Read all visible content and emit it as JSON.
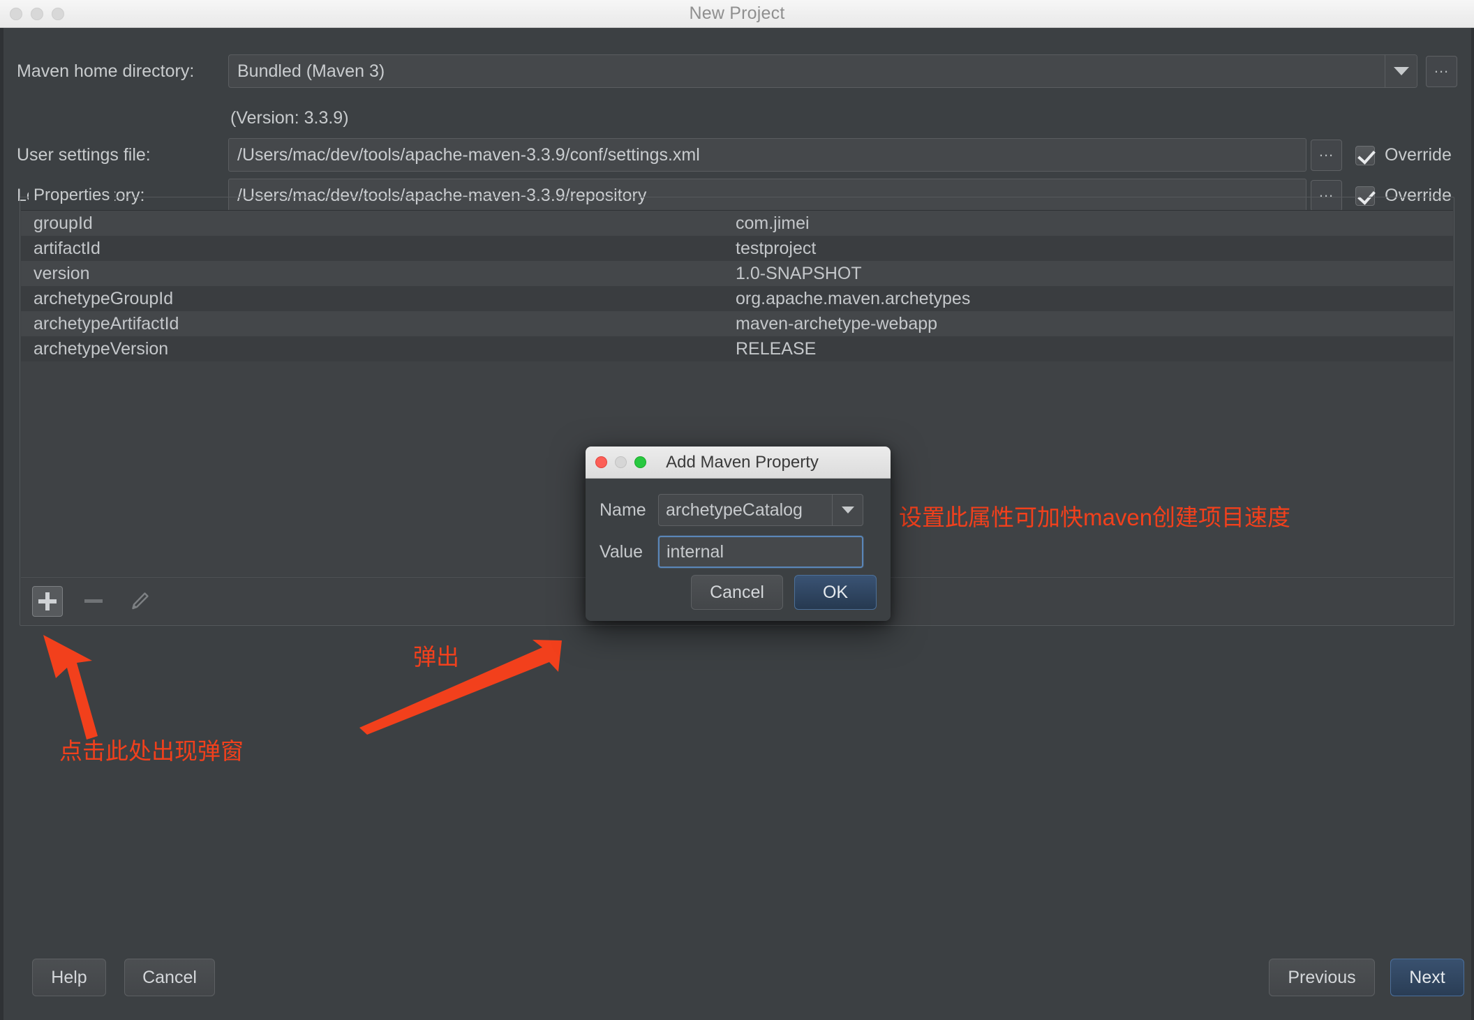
{
  "window": {
    "title": "New Project",
    "traffic_lights": [
      "close",
      "minimize",
      "maximize"
    ]
  },
  "form": {
    "maven_home": {
      "label": "Maven home directory:",
      "value": "Bundled (Maven 3)",
      "dropdown_icon": "chevron-down-icon",
      "browse_label": "...",
      "version_note": "(Version: 3.3.9)"
    },
    "user_settings": {
      "label": "User settings file:",
      "value": "/Users/mac/dev/tools/apache-maven-3.3.9/conf/settings.xml",
      "browse_label": "...",
      "override_label": "Override",
      "override_checked": true
    },
    "local_repository": {
      "label": "Local repository:",
      "value": "/Users/mac/dev/tools/apache-maven-3.3.9/repository",
      "browse_label": "...",
      "override_label": "Override",
      "override_checked": true
    }
  },
  "properties": {
    "legend": "Properties",
    "rows": [
      {
        "key": "groupId",
        "value": "com.jimei"
      },
      {
        "key": "artifactId",
        "value": "testproject"
      },
      {
        "key": "version",
        "value": "1.0-SNAPSHOT"
      },
      {
        "key": "archetypeGroupId",
        "value": "org.apache.maven.archetypes"
      },
      {
        "key": "archetypeArtifactId",
        "value": "maven-archetype-webapp"
      },
      {
        "key": "archetypeVersion",
        "value": "RELEASE"
      }
    ],
    "toolbar": {
      "add_icon": "plus-icon",
      "remove_icon": "minus-icon",
      "edit_icon": "pencil-icon"
    }
  },
  "footer": {
    "help_label": "Help",
    "cancel_label": "Cancel",
    "previous_label": "Previous",
    "next_label": "Next"
  },
  "dialog": {
    "title": "Add Maven Property",
    "name_label": "Name",
    "name_value": "archetypeCatalog",
    "name_dropdown_icon": "chevron-down-icon",
    "value_label": "Value",
    "value_value": "internal",
    "cancel_label": "Cancel",
    "ok_label": "OK"
  },
  "annotations": {
    "color": "#f2401c",
    "note_property": "设置此属性可加快maven创建项目速度",
    "note_popup": "弹出",
    "note_click": "点击此处出现弹窗",
    "arrow_to_add_button": "arrow-icon",
    "arrow_to_dialog": "arrow-icon"
  },
  "colors": {
    "window_background": "#3c4043",
    "titlebar": "#eeeeee",
    "field_background": "#45484b",
    "row_odd": "#44474a",
    "row_even": "#3a3d40",
    "primary_button": "#344d6c",
    "annotation_red": "#f2401c"
  }
}
